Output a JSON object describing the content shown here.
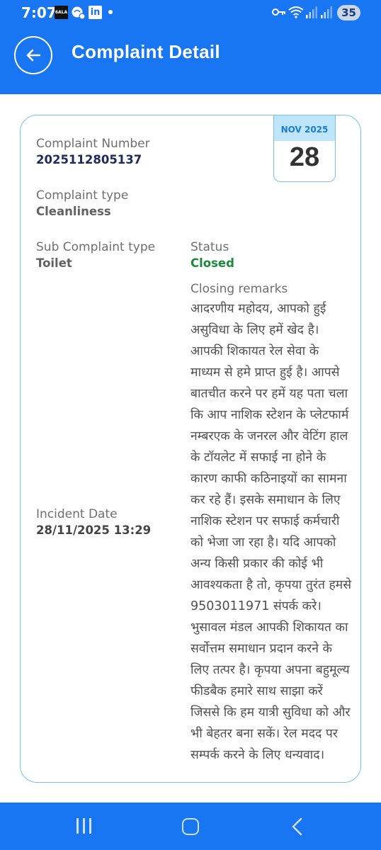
{
  "status_bar": {
    "time": "7:07",
    "notif_box_text": "6ALA",
    "notif_li_text": "in",
    "battery": "35",
    "icons": [
      "key-icon",
      "wifi-icon",
      "signal-icon",
      "signal-icon"
    ]
  },
  "header": {
    "title": "Complaint Detail",
    "back_icon": "arrow-left-icon"
  },
  "date_badge": {
    "month_year": "NOV 2025",
    "day": "28"
  },
  "complaint": {
    "number_label": "Complaint Number",
    "number_value": "2025112805137",
    "type_label": "Complaint type",
    "type_value": "Cleanliness",
    "subtype_label": "Sub Complaint type",
    "subtype_value": "Toilet",
    "status_label": "Status",
    "status_value": "Closed",
    "remarks_label": "Closing remarks",
    "remarks_text": "आदरणीय महोदय, आपको हुई असुविधा के लिए हमें खेद है। आपकी शिकायत रेल सेवा के माध्यम से हमे प्राप्त हुई है। आपसे बातचीत करने पर हमें यह पता चला कि आप नाशिक स्टेशन के प्लेटफार्म नम्बरएक के जनरल और वेटिंग हाल के टॉयलेट में सफाई ना होने के कारण काफी कठिनाइयों का सामना कर रहे हैं। इसके समाधान के लिए नाशिक स्टेशन पर सफाई कर्मचारी को भेजा जा रहा है। यदि आपको अन्य किसी प्रकार की कोई भी आवश्यकता है तो, कृपया तुरंत हमसे 9503011971 संपर्क करे। भुसावल मंडल आपकी शिकायत का सर्वोत्तम समाधान प्रदान करने के लिए तत्पर है। कृपया अपना बहुमूल्य फीडबैक हमारे साथ साझा करें जिससे कि हम यात्री सुविधा को और भी बेहतर बना सकें। रेल मदद पर सम्पर्क करने के लिए धन्यवाद।",
    "incident_label": "Incident Date",
    "incident_value": "28/11/2025 13:29"
  },
  "colors": {
    "primary": "#1976f2",
    "card_border": "#7cc0ea",
    "status_closed": "#1a8a3d",
    "number_text": "#1d2b5c"
  },
  "nav": {
    "recents_icon": "recents-icon",
    "home_icon": "home-icon",
    "back_icon": "back-chevron-icon"
  }
}
